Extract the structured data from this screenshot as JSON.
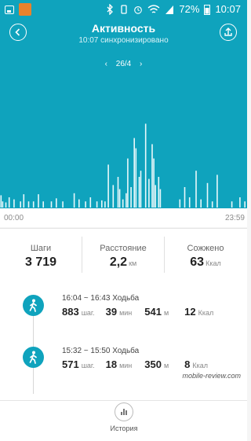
{
  "status_bar": {
    "battery": "72%",
    "time": "10:07"
  },
  "header": {
    "title": "Активность",
    "subtitle": "10:07 синхронизировано"
  },
  "date_nav": {
    "prev": "‹",
    "date": "26/4",
    "next": "›"
  },
  "chart_data": {
    "type": "bar",
    "x_start_label": "00:00",
    "x_end_label": "23:59",
    "values": [
      0.12,
      0.06,
      0.0,
      0.05,
      0.0,
      0.1,
      0.0,
      0.0,
      0.08,
      0.0,
      0.0,
      0.0,
      0.06,
      0.0,
      0.13,
      0.0,
      0.0,
      0.06,
      0.0,
      0.0,
      0.06,
      0.0,
      0.0,
      0.13,
      0.0,
      0.0,
      0.06,
      0.0,
      0.0,
      0.0,
      0.0,
      0.06,
      0.0,
      0.0,
      0.09,
      0.0,
      0.0,
      0.0,
      0.06,
      0.0,
      0.0,
      0.0,
      0.0,
      0.0,
      0.0,
      0.14,
      0.0,
      0.0,
      0.08,
      0.0,
      0.0,
      0.0,
      0.06,
      0.0,
      0.0,
      0.1,
      0.0,
      0.0,
      0.0,
      0.06,
      0.0,
      0.0,
      0.07,
      0.0,
      0.06,
      0.0,
      0.42,
      0.0,
      0.0,
      0.22,
      0.0,
      0.0,
      0.3,
      0.18,
      0.0,
      0.08,
      0.0,
      0.14,
      0.48,
      0.0,
      0.2,
      0.0,
      0.68,
      0.58,
      0.0,
      0.3,
      0.36,
      0.0,
      0.0,
      0.82,
      0.0,
      0.28,
      0.0,
      0.62,
      0.48,
      0.22,
      0.0,
      0.3,
      0.18,
      0.0,
      0.0,
      0.0,
      0.0,
      0.0,
      0.0,
      0.0,
      0.0,
      0.0,
      0.0,
      0.0,
      0.08,
      0.0,
      0.0,
      0.2,
      0.0,
      0.0,
      0.1,
      0.0,
      0.0,
      0.0,
      0.36,
      0.0,
      0.0,
      0.08,
      0.0,
      0.0,
      0.0,
      0.24,
      0.0,
      0.0,
      0.06,
      0.0,
      0.0,
      0.32,
      0.0,
      0.0,
      0.0,
      0.0,
      0.0,
      0.0,
      0.0,
      0.0,
      0.06,
      0.0,
      0.0,
      0.0,
      0.0,
      0.1,
      0.0,
      0.0,
      0.06,
      0.0
    ]
  },
  "summary": {
    "steps": {
      "label": "Шаги",
      "value": "3 719"
    },
    "distance": {
      "label": "Расстояние",
      "value": "2,2",
      "unit": "км"
    },
    "calories": {
      "label": "Сожжено",
      "value": "63",
      "unit": "Ккал"
    }
  },
  "activities": [
    {
      "time": "16:04 ~ 16:43 Ходьба",
      "steps": "883",
      "steps_unit": "шаг.",
      "minutes": "39",
      "minutes_unit": "мин",
      "meters": "541",
      "meters_unit": "м",
      "kcal": "12",
      "kcal_unit": "Ккал"
    },
    {
      "time": "15:32 ~ 15:50 Ходьба",
      "steps": "571",
      "steps_unit": "шаг.",
      "minutes": "18",
      "minutes_unit": "мин",
      "meters": "350",
      "meters_unit": "м",
      "kcal": "8",
      "kcal_unit": "Ккал"
    }
  ],
  "watermark": "mobile-review.com",
  "bottom": {
    "history_label": "История"
  },
  "colors": {
    "accent": "#0fa3bd",
    "bars": "#e9f8fb"
  },
  "icons": {
    "back": "back-icon",
    "share": "share-icon",
    "walk": "walk-icon",
    "history": "bar-chart-icon"
  }
}
